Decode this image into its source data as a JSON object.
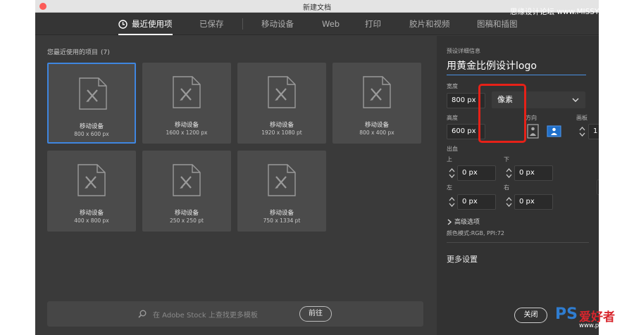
{
  "window": {
    "title": "新建文档"
  },
  "tabs": [
    {
      "label": "最近使用项"
    },
    {
      "label": "已保存"
    },
    {
      "label": "移动设备"
    },
    {
      "label": "Web"
    },
    {
      "label": "打印"
    },
    {
      "label": "胶片和视频"
    },
    {
      "label": "图稿和插图"
    }
  ],
  "recent": {
    "header": "您最近使用的项目",
    "count": "(7)",
    "items": [
      {
        "name": "移动设备",
        "size": "800 x 600 px"
      },
      {
        "name": "移动设备",
        "size": "1600 x 1200 px"
      },
      {
        "name": "移动设备",
        "size": "1920 x 1080 pt"
      },
      {
        "name": "移动设备",
        "size": "800 x 400 px"
      },
      {
        "name": "移动设备",
        "size": "400 x 800 px"
      },
      {
        "name": "移动设备",
        "size": "250 x 250 pt"
      },
      {
        "name": "移动设备",
        "size": "750 x 1334 pt"
      }
    ]
  },
  "search": {
    "placeholder": "在 Adobe Stock 上查找更多模板",
    "go_label": "前往"
  },
  "details": {
    "section_title": "预设详细信息",
    "preset_name": "用黄金比例设计logo",
    "width_label": "宽度",
    "width_value": "800 px",
    "unit_value": "像素",
    "height_label": "高度",
    "height_value": "600 px",
    "orientation_label": "方向",
    "artboards_label": "画板",
    "artboards_value": "1",
    "bleed_label": "出血",
    "bleed": {
      "top_label": "上",
      "top_value": "0 px",
      "bottom_label": "下",
      "bottom_value": "0 px",
      "left_label": "左",
      "left_value": "0 px",
      "right_label": "右",
      "right_value": "0 px"
    },
    "advanced_label": "高级选项",
    "color_mode": "颜色模式:RGB, PPI:72",
    "more_settings": "更多设置",
    "close_label": "关闭"
  },
  "watermark": {
    "top_text": "思缘设计论坛  www.MISSYUAN.COM",
    "logo_ps": "PS",
    "logo_cn": "爱好者",
    "logo_url": "www.psahz.com"
  },
  "colors": {
    "accent_blue": "#3f86e0",
    "highlight_red": "#e62118",
    "panel_bg": "#323232",
    "grid_bg": "#3a3a3a"
  }
}
